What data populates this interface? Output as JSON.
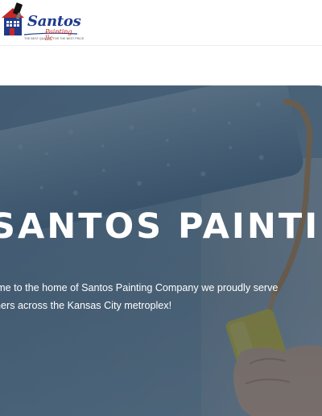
{
  "header": {
    "logo": {
      "name": "Santos",
      "subname": "Painting llc",
      "tagline": "THE BEST QUALITY FOR THE BEST PRICE",
      "icon": "paint-brush-house-icon"
    }
  },
  "hero": {
    "title": "SANTOS PAINTIN",
    "text_line1": "lcome to the home of Santos Painting Company we proudly serve",
    "text_line2": "tomers across the Kansas City metroplex!",
    "background": "paint-roller-on-wall-image"
  },
  "colors": {
    "logo_blue": "#1f3a8a",
    "logo_red": "#c62828",
    "hero_overlay": "#1e2c3c"
  }
}
